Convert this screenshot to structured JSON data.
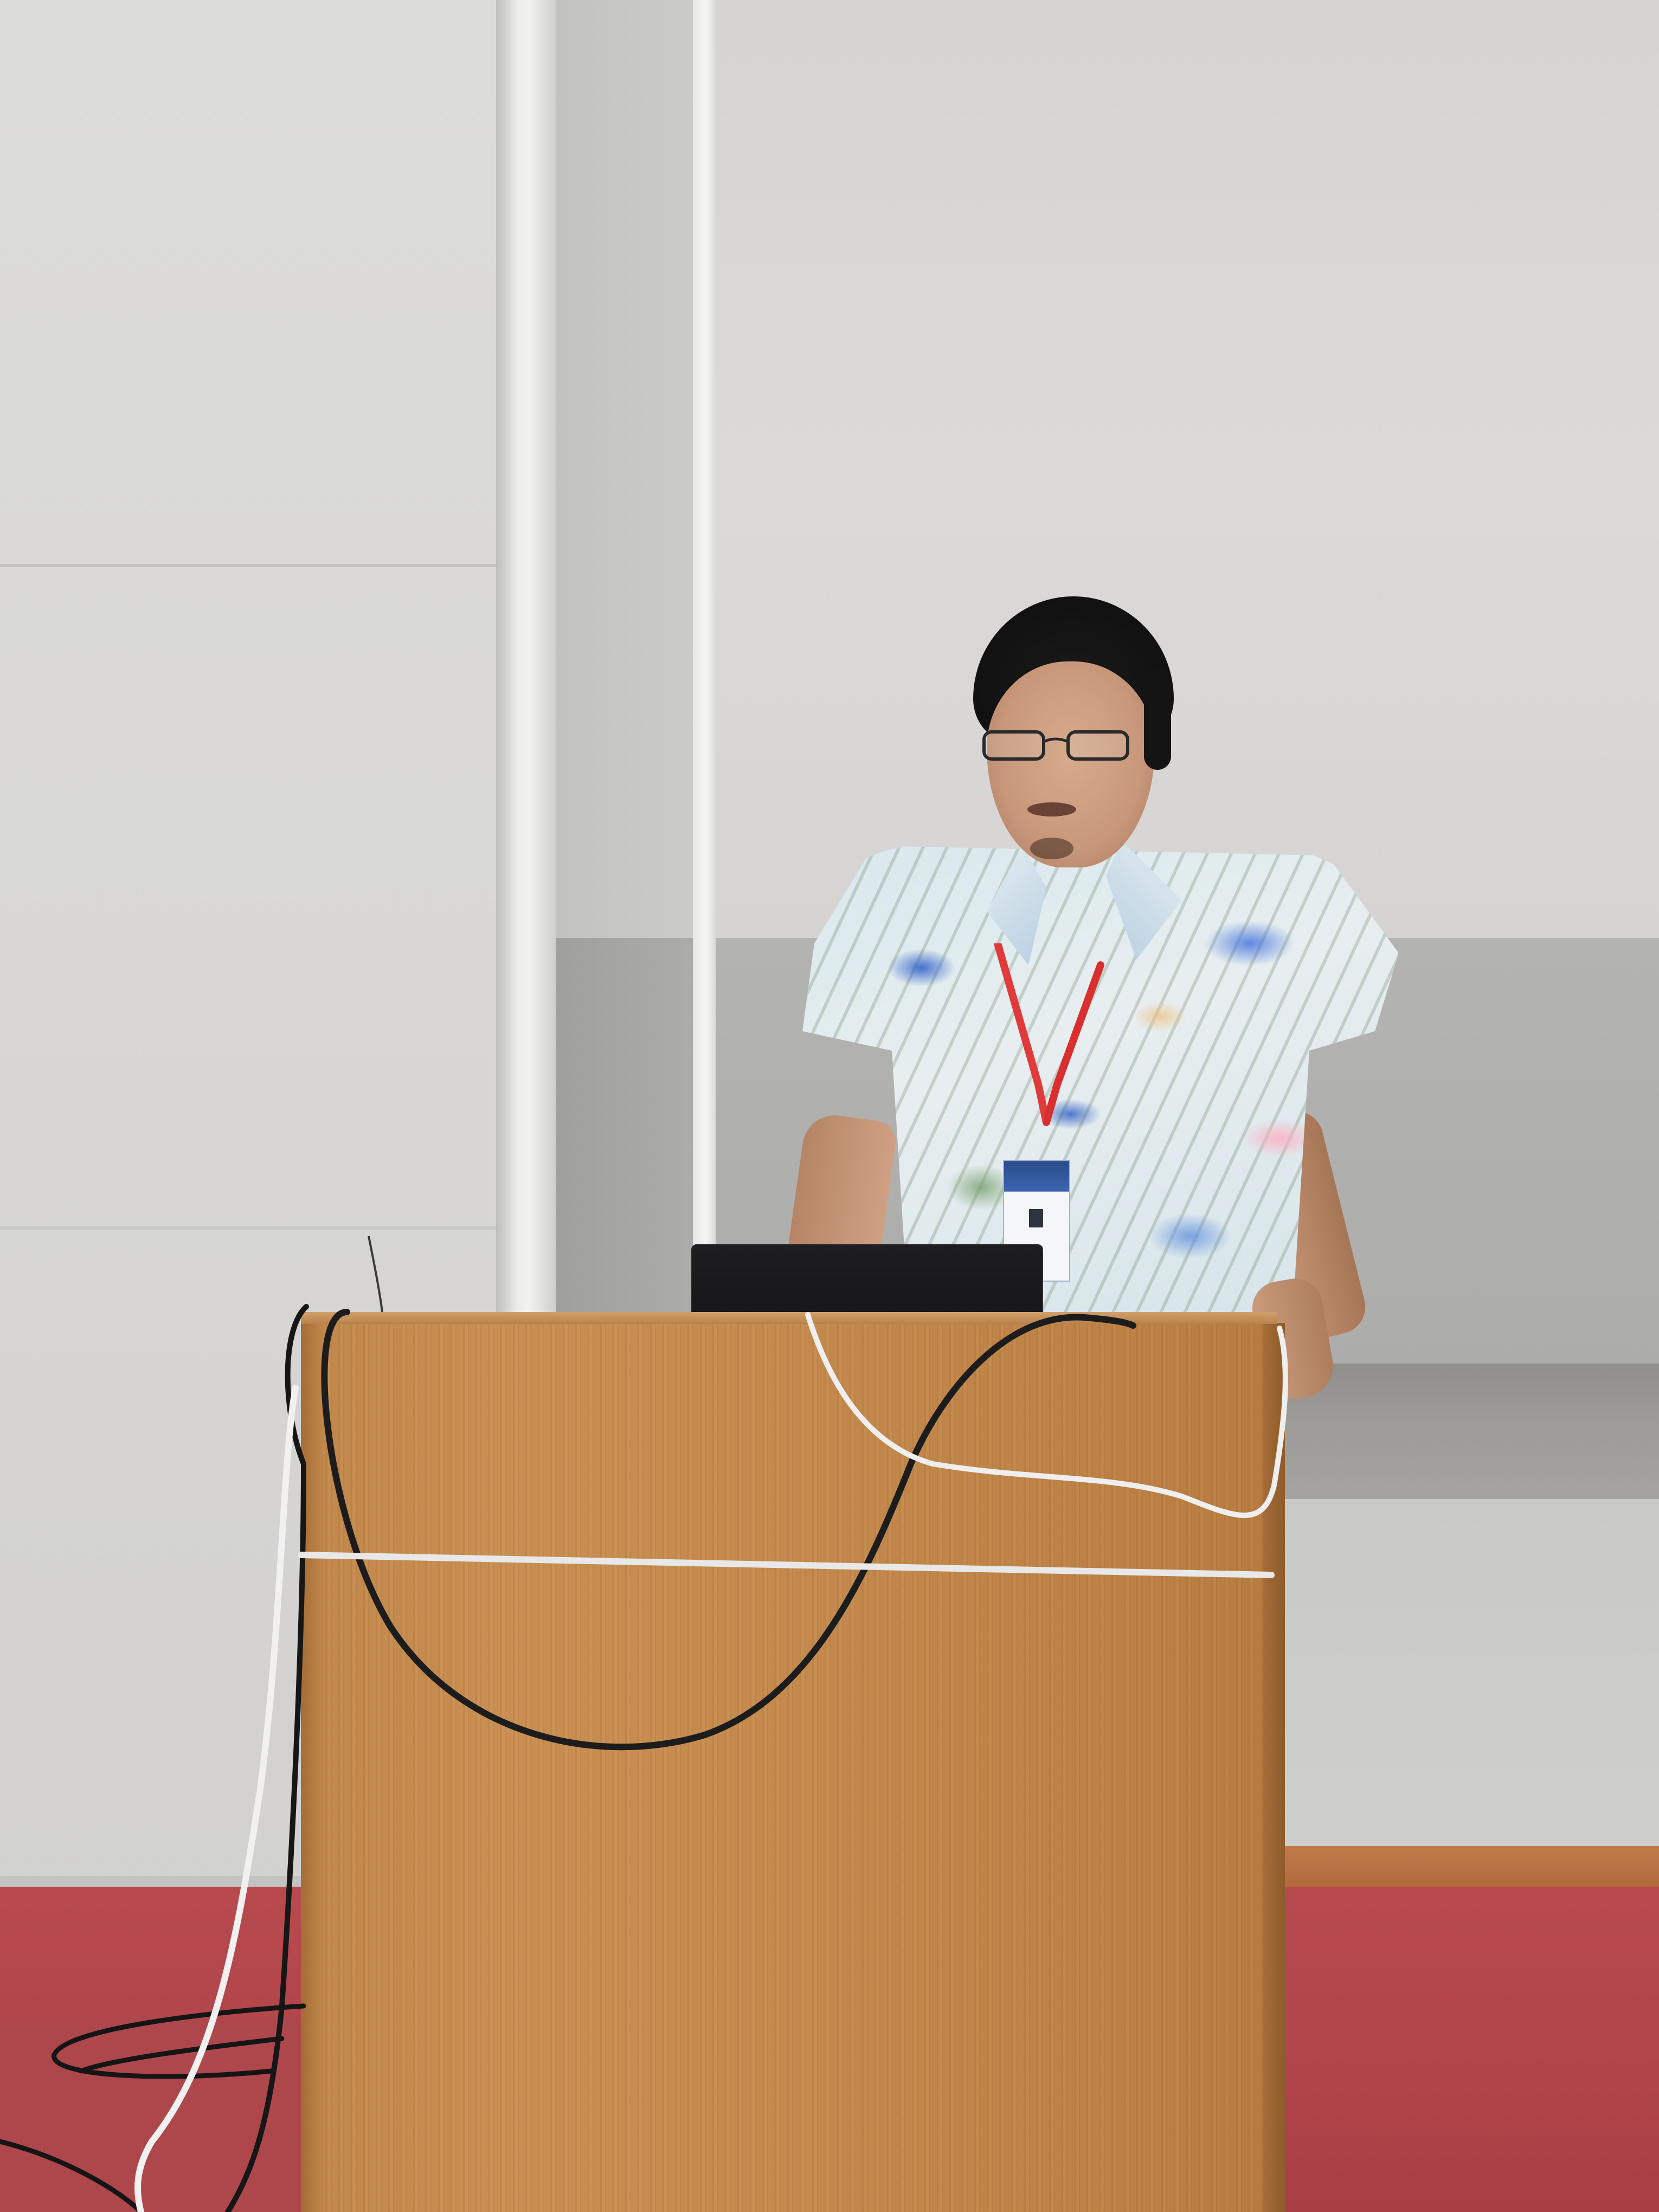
{
  "scene": {
    "colors": {
      "wall": "#d9d8d6",
      "wall_band": "#acacaa",
      "lectern_wood": "#c48a4d",
      "floor_carpet": "#b04449",
      "laptop": "#18181a",
      "lanyard": "#e03a3a",
      "shirt_base": "#dde9ee"
    },
    "elements": [
      "wall",
      "pillar",
      "presenter",
      "shirt",
      "lanyard-badge",
      "laptop",
      "lectern",
      "cables",
      "floor"
    ]
  }
}
